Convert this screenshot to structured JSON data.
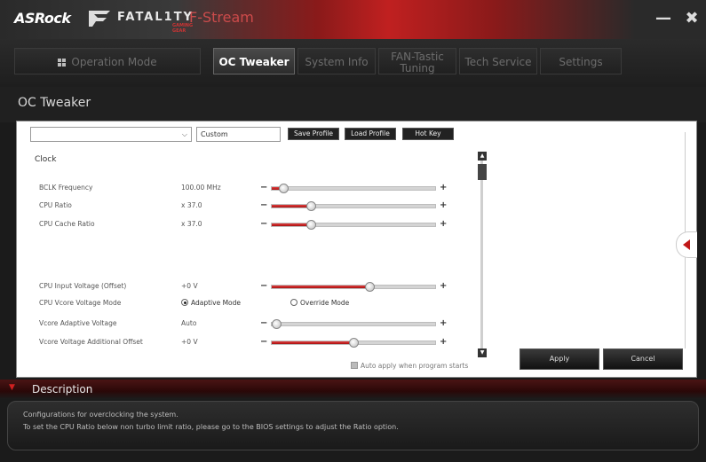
{
  "titlebar": {
    "brand": "ASRock",
    "fatality": "FATAL1TY",
    "fatality_sub": "GAMING GEAR",
    "app_title": "F-Stream",
    "minimize_label": "—",
    "close_label": "✖"
  },
  "nav": {
    "tabs": [
      {
        "label": "Operation Mode",
        "active": false
      },
      {
        "label": "OC Tweaker",
        "active": true
      },
      {
        "label": "System Info",
        "active": false
      },
      {
        "label": "FAN-Tastic Tuning",
        "active": false
      },
      {
        "label": "Tech Service",
        "active": false
      },
      {
        "label": "Settings",
        "active": false
      }
    ]
  },
  "page": {
    "title": "OC Tweaker"
  },
  "profile": {
    "dropdown_value": "",
    "name_value": "Custom",
    "save_label": "Save Profile",
    "load_label": "Load Profile",
    "hotkey_label": "Hot Key"
  },
  "clock": {
    "section_label": "Clock",
    "rows": [
      {
        "label": "BCLK Frequency",
        "value": "100.00 MHz",
        "level": 0.07
      },
      {
        "label": "CPU Ratio",
        "value": "x 37.0",
        "level": 0.24
      },
      {
        "label": "CPU Cache Ratio",
        "value": "x 37.0",
        "level": 0.24
      }
    ]
  },
  "voltage": {
    "input_offset": {
      "label": "CPU Input Voltage (Offset)",
      "value": "+0 V",
      "level": 0.6
    },
    "vcore_mode": {
      "label": "CPU Vcore Voltage Mode",
      "option_adaptive": "Adaptive Mode",
      "option_override": "Override Mode",
      "selected": "Adaptive Mode"
    },
    "vcore_adaptive": {
      "label": "Vcore Adaptive Voltage",
      "value": "Auto",
      "level": 0.0
    },
    "vcore_additional": {
      "label": "Vcore Voltage Additional Offset",
      "value": "+0 V",
      "level": 0.5
    }
  },
  "auto_apply_label": "Auto apply when program starts",
  "actions": {
    "apply": "Apply",
    "cancel": "Cancel"
  },
  "description": {
    "title": "Description",
    "line1": "Configurations for overclocking the system.",
    "line2": "To set the CPU Ratio below non turbo limit ratio, please go to the BIOS settings to adjust the Ratio option."
  },
  "colors": {
    "accent": "#c01818",
    "background": "#1b1b1b",
    "panel": "#ffffff"
  }
}
